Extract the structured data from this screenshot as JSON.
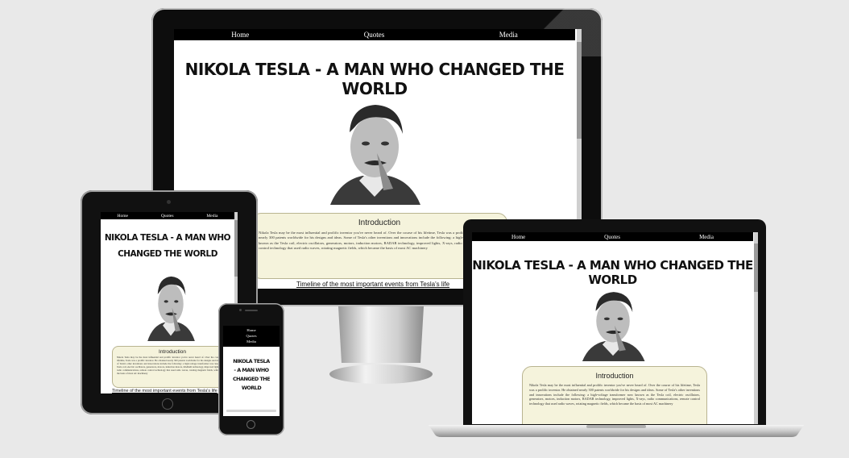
{
  "site": {
    "nav": [
      "Home",
      "Quotes",
      "Media"
    ],
    "title": "NIKOLA TESLA - A MAN WHO CHANGED THE WORLD",
    "title_tablet_line1": "NIKOLA TESLA - A MAN WHO",
    "title_tablet_line2": "CHANGED THE WORLD",
    "title_phone_lines": [
      "NIKOLA TESLA",
      "- A MAN WHO",
      "CHANGED THE",
      "WORLD"
    ],
    "intro_heading": "Introduction",
    "intro_text": "Nikola Tesla may be the most influential and prolific inventor you've never heard of. Over the course of his lifetime, Tesla was a prolific inventor. He obtained nearly 300 patents worldwide for his designs and ideas. Some of Tesla's other inventions and innovations include the following: a high-voltage transformer now known as the Tesla coil, electric oscillators, generators, motors, induction motors, RADAR technology, improved lights, X-rays, radio communications, remote control technology that used radio waves, rotating magnetic fields, which became the basis of most AC machinery",
    "timeline_link": "Timeline of the most important events from Tesla's life",
    "timeline_link_tablet": "Timeline of the most important events from Tesla's life"
  },
  "devices": [
    "desktop-monitor",
    "laptop",
    "tablet",
    "phone"
  ],
  "colors": {
    "background": "#e9e9e9",
    "nav": "#000000",
    "intro_bg": "#f5f3dc",
    "frame": "#111111"
  },
  "icons": [
    "portrait-image"
  ]
}
